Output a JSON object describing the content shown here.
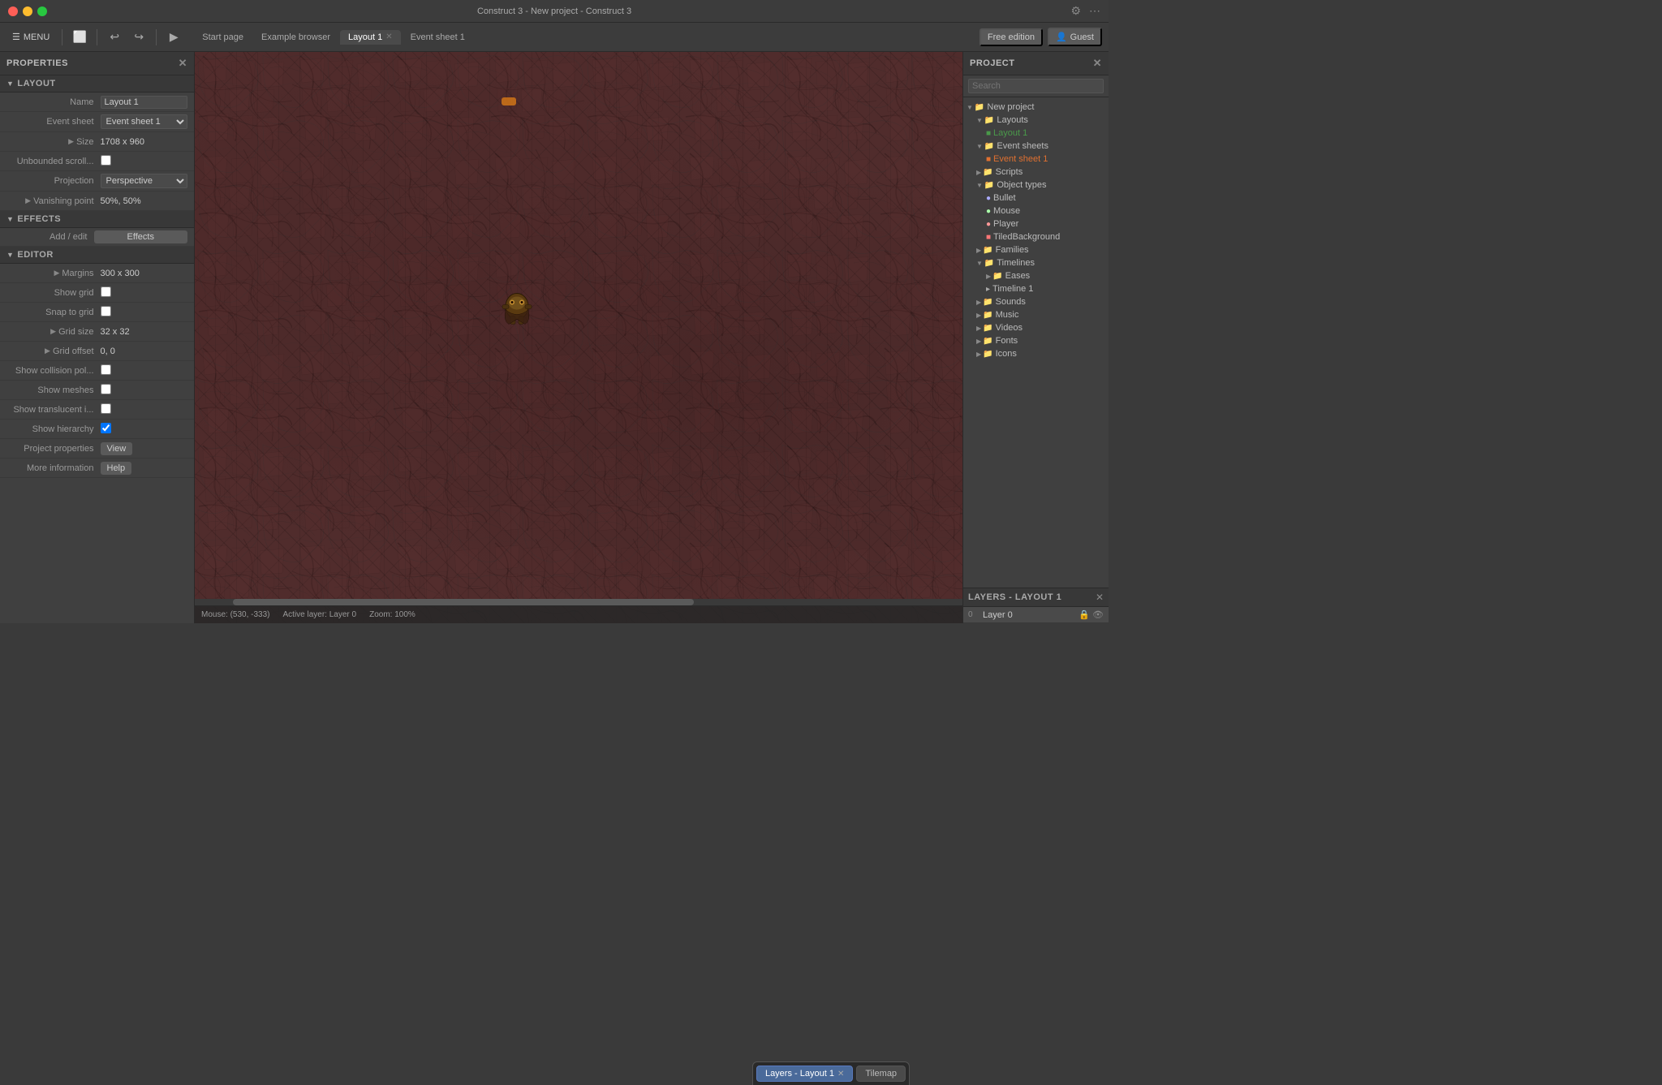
{
  "window": {
    "title": "Construct 3 - New project - Construct 3"
  },
  "titlebar": {
    "title": "Construct 3 - New project - Construct 3",
    "close_icon": "✕",
    "gear_icon": "⚙",
    "ellipsis_icon": "⋯"
  },
  "toolbar": {
    "menu_label": "MENU",
    "save_icon": "💾",
    "undo_icon": "↩",
    "redo_icon": "↪",
    "play_icon": "▶",
    "tabs": [
      {
        "label": "Start page",
        "active": false,
        "closable": false
      },
      {
        "label": "Example browser",
        "active": false,
        "closable": false
      },
      {
        "label": "Layout 1",
        "active": true,
        "closable": true
      },
      {
        "label": "Event sheet 1",
        "active": false,
        "closable": false
      }
    ],
    "free_edition_label": "Free edition",
    "guest_label": "Guest",
    "guest_icon": "👤"
  },
  "properties_panel": {
    "title": "PROPERTIES",
    "close_icon": "✕",
    "sections": {
      "layout": {
        "label": "LAYOUT",
        "fields": {
          "name_label": "Name",
          "name_value": "Layout 1",
          "event_sheet_label": "Event sheet",
          "event_sheet_value": "Event sheet 1",
          "size_label": "Size",
          "size_value": "1708 x 960",
          "unbounded_scroll_label": "Unbounded scroll...",
          "projection_label": "Projection",
          "projection_value": "Perspective",
          "vanishing_point_label": "Vanishing point",
          "vanishing_point_value": "50%, 50%"
        }
      },
      "effects": {
        "label": "EFFECTS",
        "add_edit_label": "Add / edit",
        "effects_btn_label": "Effects"
      },
      "editor": {
        "label": "EDITOR",
        "fields": {
          "margins_label": "Margins",
          "margins_value": "300 x 300",
          "show_grid_label": "Show grid",
          "snap_to_grid_label": "Snap to grid",
          "grid_size_label": "Grid size",
          "grid_size_value": "32 x 32",
          "grid_offset_label": "Grid offset",
          "grid_offset_value": "0, 0",
          "show_collision_label": "Show collision pol...",
          "show_meshes_label": "Show meshes",
          "show_translucent_label": "Show translucent i...",
          "show_hierarchy_label": "Show hierarchy",
          "project_properties_label": "Project properties",
          "project_properties_btn": "View",
          "more_information_label": "More information",
          "more_info_btn": "Help"
        }
      }
    }
  },
  "canvas": {
    "mouse_label": "Mouse:",
    "mouse_pos": "(530, -333)",
    "active_layer_label": "Active layer: Layer 0",
    "zoom_label": "Zoom: 100%"
  },
  "project_panel": {
    "title": "PROJECT",
    "close_icon": "✕",
    "search_placeholder": "Search",
    "tree": [
      {
        "indent": 0,
        "type": "folder",
        "label": "New project",
        "expanded": true
      },
      {
        "indent": 1,
        "type": "folder",
        "label": "Layouts",
        "expanded": true
      },
      {
        "indent": 2,
        "type": "layout",
        "label": "Layout 1",
        "selected": false,
        "color": "#4a9a4a"
      },
      {
        "indent": 1,
        "type": "folder",
        "label": "Event sheets",
        "expanded": true
      },
      {
        "indent": 2,
        "type": "event",
        "label": "Event sheet 1",
        "selected": false,
        "color": "#e07030"
      },
      {
        "indent": 1,
        "type": "folder",
        "label": "Scripts",
        "expanded": false
      },
      {
        "indent": 1,
        "type": "folder",
        "label": "Object types",
        "expanded": true
      },
      {
        "indent": 2,
        "type": "object",
        "label": "Bullet",
        "color": "#aaaaff"
      },
      {
        "indent": 2,
        "type": "object",
        "label": "Mouse",
        "color": "#aaffaa"
      },
      {
        "indent": 2,
        "type": "object",
        "label": "Player",
        "color": "#ff9999"
      },
      {
        "indent": 2,
        "type": "object",
        "label": "TiledBackground",
        "color": "#ff7777"
      },
      {
        "indent": 1,
        "type": "folder",
        "label": "Families",
        "expanded": false
      },
      {
        "indent": 1,
        "type": "folder",
        "label": "Timelines",
        "expanded": true
      },
      {
        "indent": 2,
        "type": "folder",
        "label": "Eases",
        "expanded": false
      },
      {
        "indent": 2,
        "type": "item",
        "label": "Timeline 1"
      },
      {
        "indent": 1,
        "type": "folder",
        "label": "Sounds",
        "expanded": false
      },
      {
        "indent": 1,
        "type": "folder",
        "label": "Music",
        "expanded": false
      },
      {
        "indent": 1,
        "type": "folder",
        "label": "Videos",
        "expanded": false
      },
      {
        "indent": 1,
        "type": "folder",
        "label": "Fonts",
        "expanded": false
      },
      {
        "indent": 1,
        "type": "folder",
        "label": "Icons",
        "expanded": false
      }
    ]
  },
  "layers_panel": {
    "title": "LAYERS - LAYOUT 1",
    "close_icon": "✕",
    "layers": [
      {
        "num": "0",
        "name": "Layer 0"
      }
    ]
  },
  "bottom_tabs": [
    {
      "label": "Layers - Layout 1",
      "active": true,
      "closable": true
    },
    {
      "label": "Tilemap",
      "active": false,
      "closable": false
    }
  ]
}
